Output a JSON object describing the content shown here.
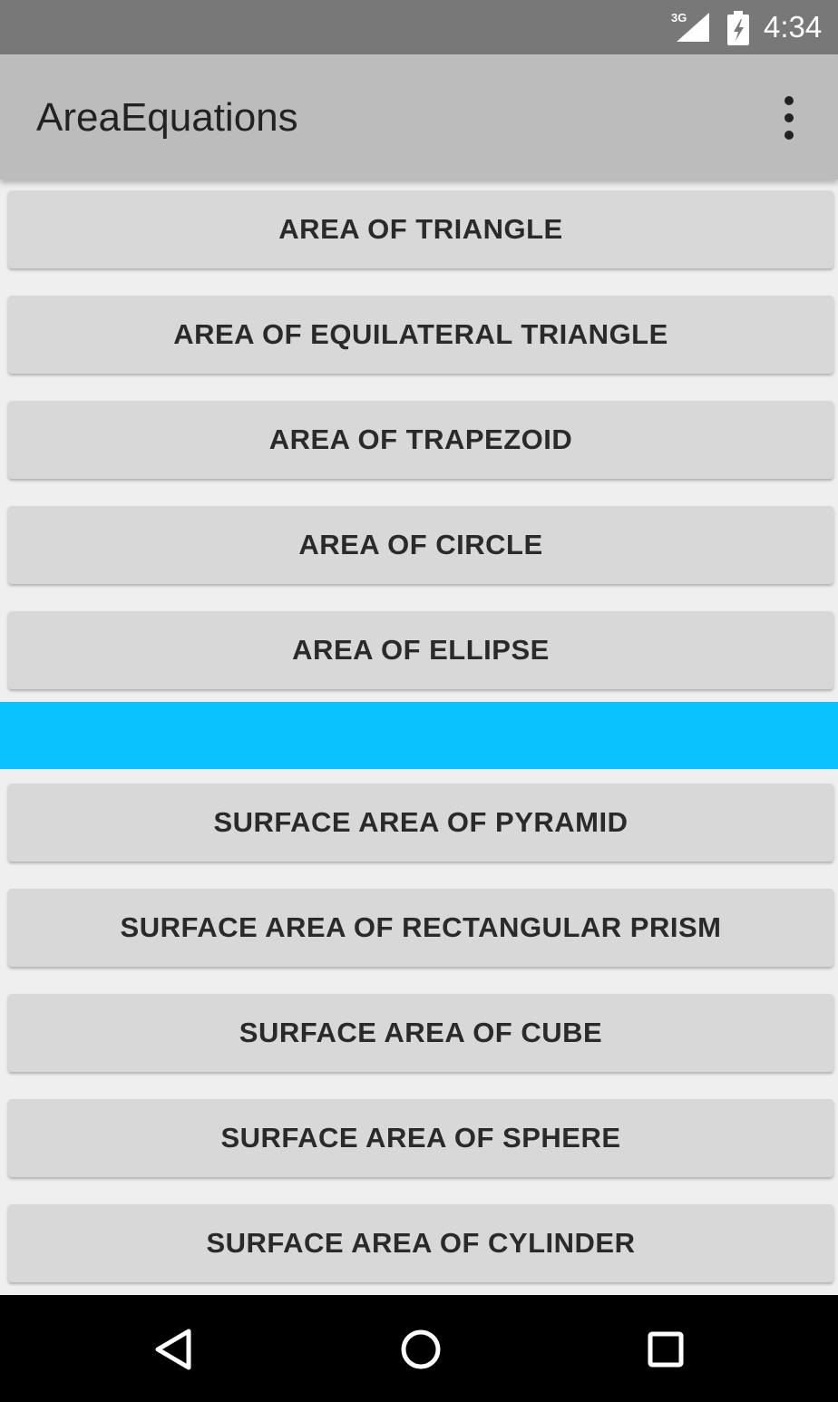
{
  "status_bar": {
    "network": "3G",
    "time": "4:34",
    "icons": [
      "signal-icon",
      "battery-icon"
    ]
  },
  "app_bar": {
    "title": "AreaEquations",
    "overflow_icon": "more-vert-icon"
  },
  "colors": {
    "status_bar": "#787878",
    "app_bar": "#bcbcbc",
    "background": "#efefef",
    "button": "#d7d8d7",
    "accent_band": "#0ac3fe",
    "nav_bar": "#000000"
  },
  "area_buttons": [
    {
      "label": "AREA OF TRIANGLE"
    },
    {
      "label": "AREA OF EQUILATERAL TRIANGLE"
    },
    {
      "label": "AREA OF TRAPEZOID"
    },
    {
      "label": "AREA OF CIRCLE"
    },
    {
      "label": "AREA OF ELLIPSE"
    }
  ],
  "surface_area_buttons": [
    {
      "label": "SURFACE AREA OF PYRAMID"
    },
    {
      "label": "SURFACE AREA OF RECTANGULAR PRISM"
    },
    {
      "label": "SURFACE AREA OF CUBE"
    },
    {
      "label": "SURFACE AREA OF SPHERE"
    },
    {
      "label": "SURFACE AREA OF CYLINDER"
    }
  ],
  "nav_bar": {
    "icons": [
      "back-icon",
      "home-icon",
      "recents-icon"
    ]
  }
}
